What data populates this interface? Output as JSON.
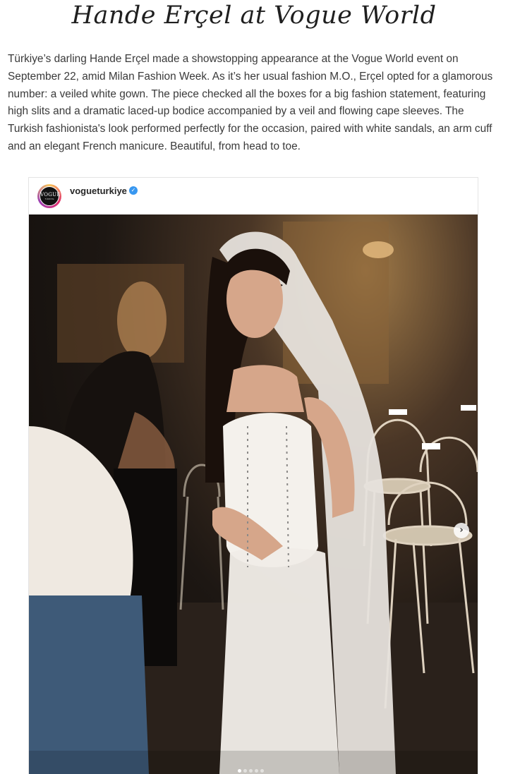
{
  "article": {
    "title": "Hande Erçel at Vogue World",
    "body": "Türkiye’s darling Hande Erçel made a showstopping appearance at the Vogue World event on September 22, amid Milan Fashion Week. As it’s her usual fashion M.O., Erçel opted for a glamorous number: a veiled white gown. The piece checked all the boxes for a big fashion statement, featuring high slits and a dramatic laced-up bodice accompanied by a veil and flowing cape sleeves. The Turkish fashionista's look performed perfectly for the occasion, paired with white sandals, an arm cuff and an elegant French manicure. Beautiful, from head to toe."
  },
  "instagram_embed": {
    "username": "vogueturkiye",
    "avatar_text": "VOGUE",
    "avatar_subtext": "TÜRKİYE",
    "verified_icon": "verified-badge-icon",
    "next_icon": "chevron-right-icon",
    "next_glyph": "›",
    "carousel": {
      "total": 5,
      "current": 1
    },
    "chair_tags": [
      "L-03-10",
      "L-03-10",
      "L-03-10"
    ],
    "colors": {
      "verified": "#3897f0",
      "dress": "#f2efea",
      "background": "#1a1410"
    }
  }
}
